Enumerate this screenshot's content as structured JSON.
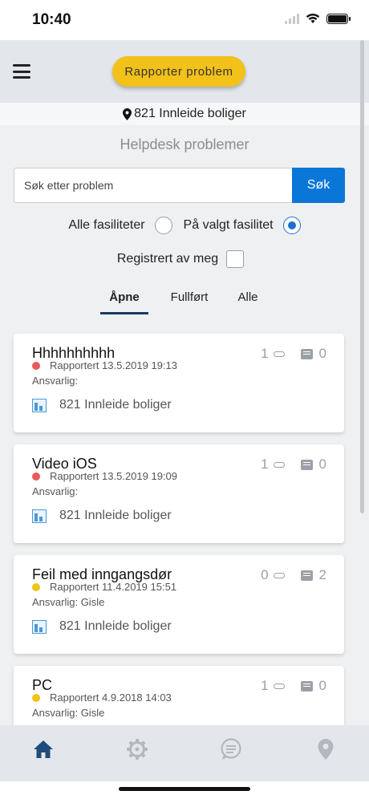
{
  "status_bar": {
    "time": "10:40"
  },
  "header": {
    "report_button": "Rapporter problem"
  },
  "facility": {
    "name": "821 Innleide boliger"
  },
  "page_title": "Helpdesk problemer",
  "search": {
    "placeholder": "Søk etter problem",
    "button": "Søk"
  },
  "filters": {
    "all_facilities": "Alle fasiliteter",
    "selected_facility": "På valgt fasilitet",
    "selected": "selected_facility",
    "registered_by_me": "Registrert av meg",
    "registered_by_me_checked": false
  },
  "tabs": [
    {
      "label": "Åpne",
      "active": true
    },
    {
      "label": "Fullført",
      "active": false
    },
    {
      "label": "Alle",
      "active": false
    }
  ],
  "problems": [
    {
      "title": "Hhhhhhhhhh",
      "attachments": "1",
      "comments": "0",
      "status_color": "#e85a5a",
      "reported": "Rapportert 13.5.2019 19:13",
      "responsible": "Ansvarlig:",
      "facility": "821 Innleide boliger"
    },
    {
      "title": "Video iOS",
      "attachments": "1",
      "comments": "0",
      "status_color": "#e85a5a",
      "reported": "Rapportert 13.5.2019 19:09",
      "responsible": "Ansvarlig:",
      "facility": "821 Innleide boliger"
    },
    {
      "title": "Feil med inngangsdør",
      "attachments": "0",
      "comments": "2",
      "status_color": "#f0c419",
      "reported": "Rapportert 11.4.2019 15:51",
      "responsible": "Ansvarlig: Gisle",
      "facility": "821 Innleide boliger"
    },
    {
      "title": "PC",
      "attachments": "1",
      "comments": "0",
      "status_color": "#f0c419",
      "reported": "Rapportert 4.9.2018 14:03",
      "responsible": "Ansvarlig: Gisle",
      "facility": ""
    }
  ],
  "tabbar": {
    "items": [
      {
        "icon": "home-icon",
        "active": true
      },
      {
        "icon": "settings-icon",
        "active": false
      },
      {
        "icon": "chat-icon",
        "active": false
      },
      {
        "icon": "location-icon",
        "active": false
      }
    ],
    "active_color": "#1f4c7c",
    "inactive_color": "#b2b8be"
  }
}
